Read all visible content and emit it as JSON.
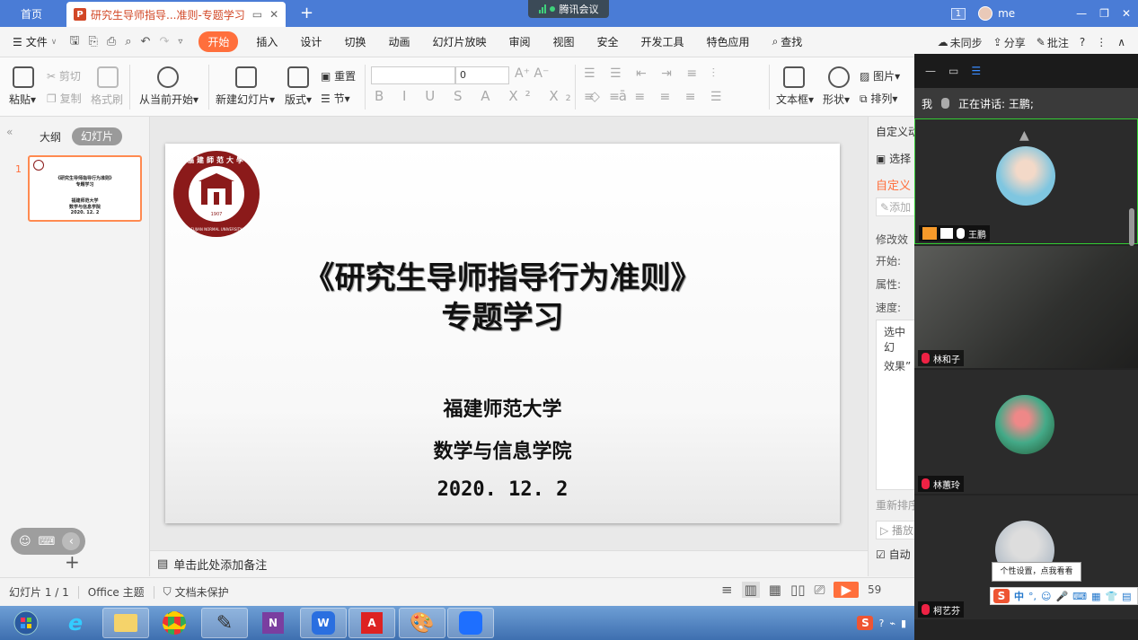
{
  "titlebar": {
    "home_tab": "首页",
    "doc_badge": "P",
    "doc_tab": "研究生导师指导...准则-专题学习",
    "meeting_app": "腾讯会议",
    "window_count": "1",
    "user": "me"
  },
  "menu": {
    "file": "文件",
    "tabs": [
      "开始",
      "插入",
      "设计",
      "切换",
      "动画",
      "幻灯片放映",
      "审阅",
      "视图",
      "安全",
      "开发工具",
      "特色应用"
    ],
    "search": "查找",
    "sync": "未同步",
    "share": "分享",
    "comment": "批注"
  },
  "ribbon": {
    "paste": "粘贴",
    "cut": "剪切",
    "copy": "复制",
    "format_painter": "格式刷",
    "from_current": "从当前开始",
    "new_slide": "新建幻灯片",
    "layout": "版式",
    "reset": "重置",
    "section": "节",
    "font_size": "0",
    "textbox": "文本框",
    "shape": "形状",
    "picture": "图片",
    "arrange": "排列"
  },
  "left_panel": {
    "outline_tab": "大纲",
    "slides_tab": "幻灯片",
    "slide_number": "1",
    "thumb_lines": [
      "《研究生导师指导行为准则》",
      "专题学习",
      "福建师范大学",
      "数学与信息学院",
      "2020. 12. 2"
    ]
  },
  "slide": {
    "logo_center": "1907",
    "logo_top": "福建師范大學",
    "logo_bottom": "FUJIAN NORMAL UNIVERSITY",
    "title_line1": "《研究生导师指导行为准则》",
    "title_line2": "专题学习",
    "university": "福建师范大学",
    "college": "数学与信息学院",
    "date": "2020. 12. 2"
  },
  "notes_placeholder": "单击此处添加备注",
  "right_panel": {
    "title": "自定义动",
    "select": "选择",
    "custom": "自定义",
    "add": "添加",
    "modify": "修改效",
    "start": "开始:",
    "property": "属性:",
    "speed": "速度:",
    "hint_line1": "选中幻",
    "hint_line2": "效果”",
    "reorder": "重新排序",
    "play": "播放",
    "auto": "自动"
  },
  "status": {
    "slide_info": "幻灯片 1 / 1",
    "theme": "Office 主题",
    "protection": "文档未保护",
    "zoom": "59"
  },
  "meeting": {
    "me_label": "我",
    "speaking": "正在讲话: 王鹏;",
    "participants": [
      {
        "name": "王鹏"
      },
      {
        "name": "林和子"
      },
      {
        "name": "林蕙玲"
      },
      {
        "name": "柯艺芬"
      }
    ],
    "tooltip": "个性设置，点我看看",
    "ime_lang": "中"
  },
  "colors": {
    "accent": "#ff6f3c",
    "titlebar": "#4a7cd6",
    "ppt_red": "#d24726",
    "logo_red": "#8b1a1a"
  }
}
